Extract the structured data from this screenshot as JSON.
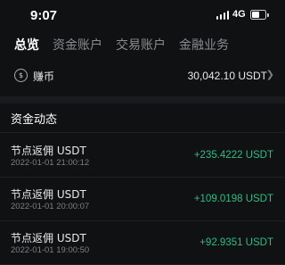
{
  "status_bar": {
    "time": "9:07",
    "network": "4G",
    "battery_level": 0.6
  },
  "tabs": [
    {
      "label": "总览",
      "active": true
    },
    {
      "label": "资金账户",
      "active": false
    },
    {
      "label": "交易账户",
      "active": false
    },
    {
      "label": "金融业务",
      "active": false
    }
  ],
  "earn": {
    "icon": "earn-coin-icon",
    "label": "赚币",
    "value": "30,042.10 USDT"
  },
  "section": {
    "title": "资金动态"
  },
  "transactions": [
    {
      "title": "节点返佣 USDT",
      "time": "2022-01-01 21:00:12",
      "amount": "+235.4222 USDT"
    },
    {
      "title": "节点返佣 USDT",
      "time": "2022-01-01 20:00:07",
      "amount": "+109.0198 USDT"
    },
    {
      "title": "节点返佣 USDT",
      "time": "2022-01-01 19:00:50",
      "amount": "+92.9351 USDT"
    }
  ],
  "colors": {
    "background": "#101113",
    "positive": "#2ebd85",
    "muted": "#7d7f84"
  }
}
